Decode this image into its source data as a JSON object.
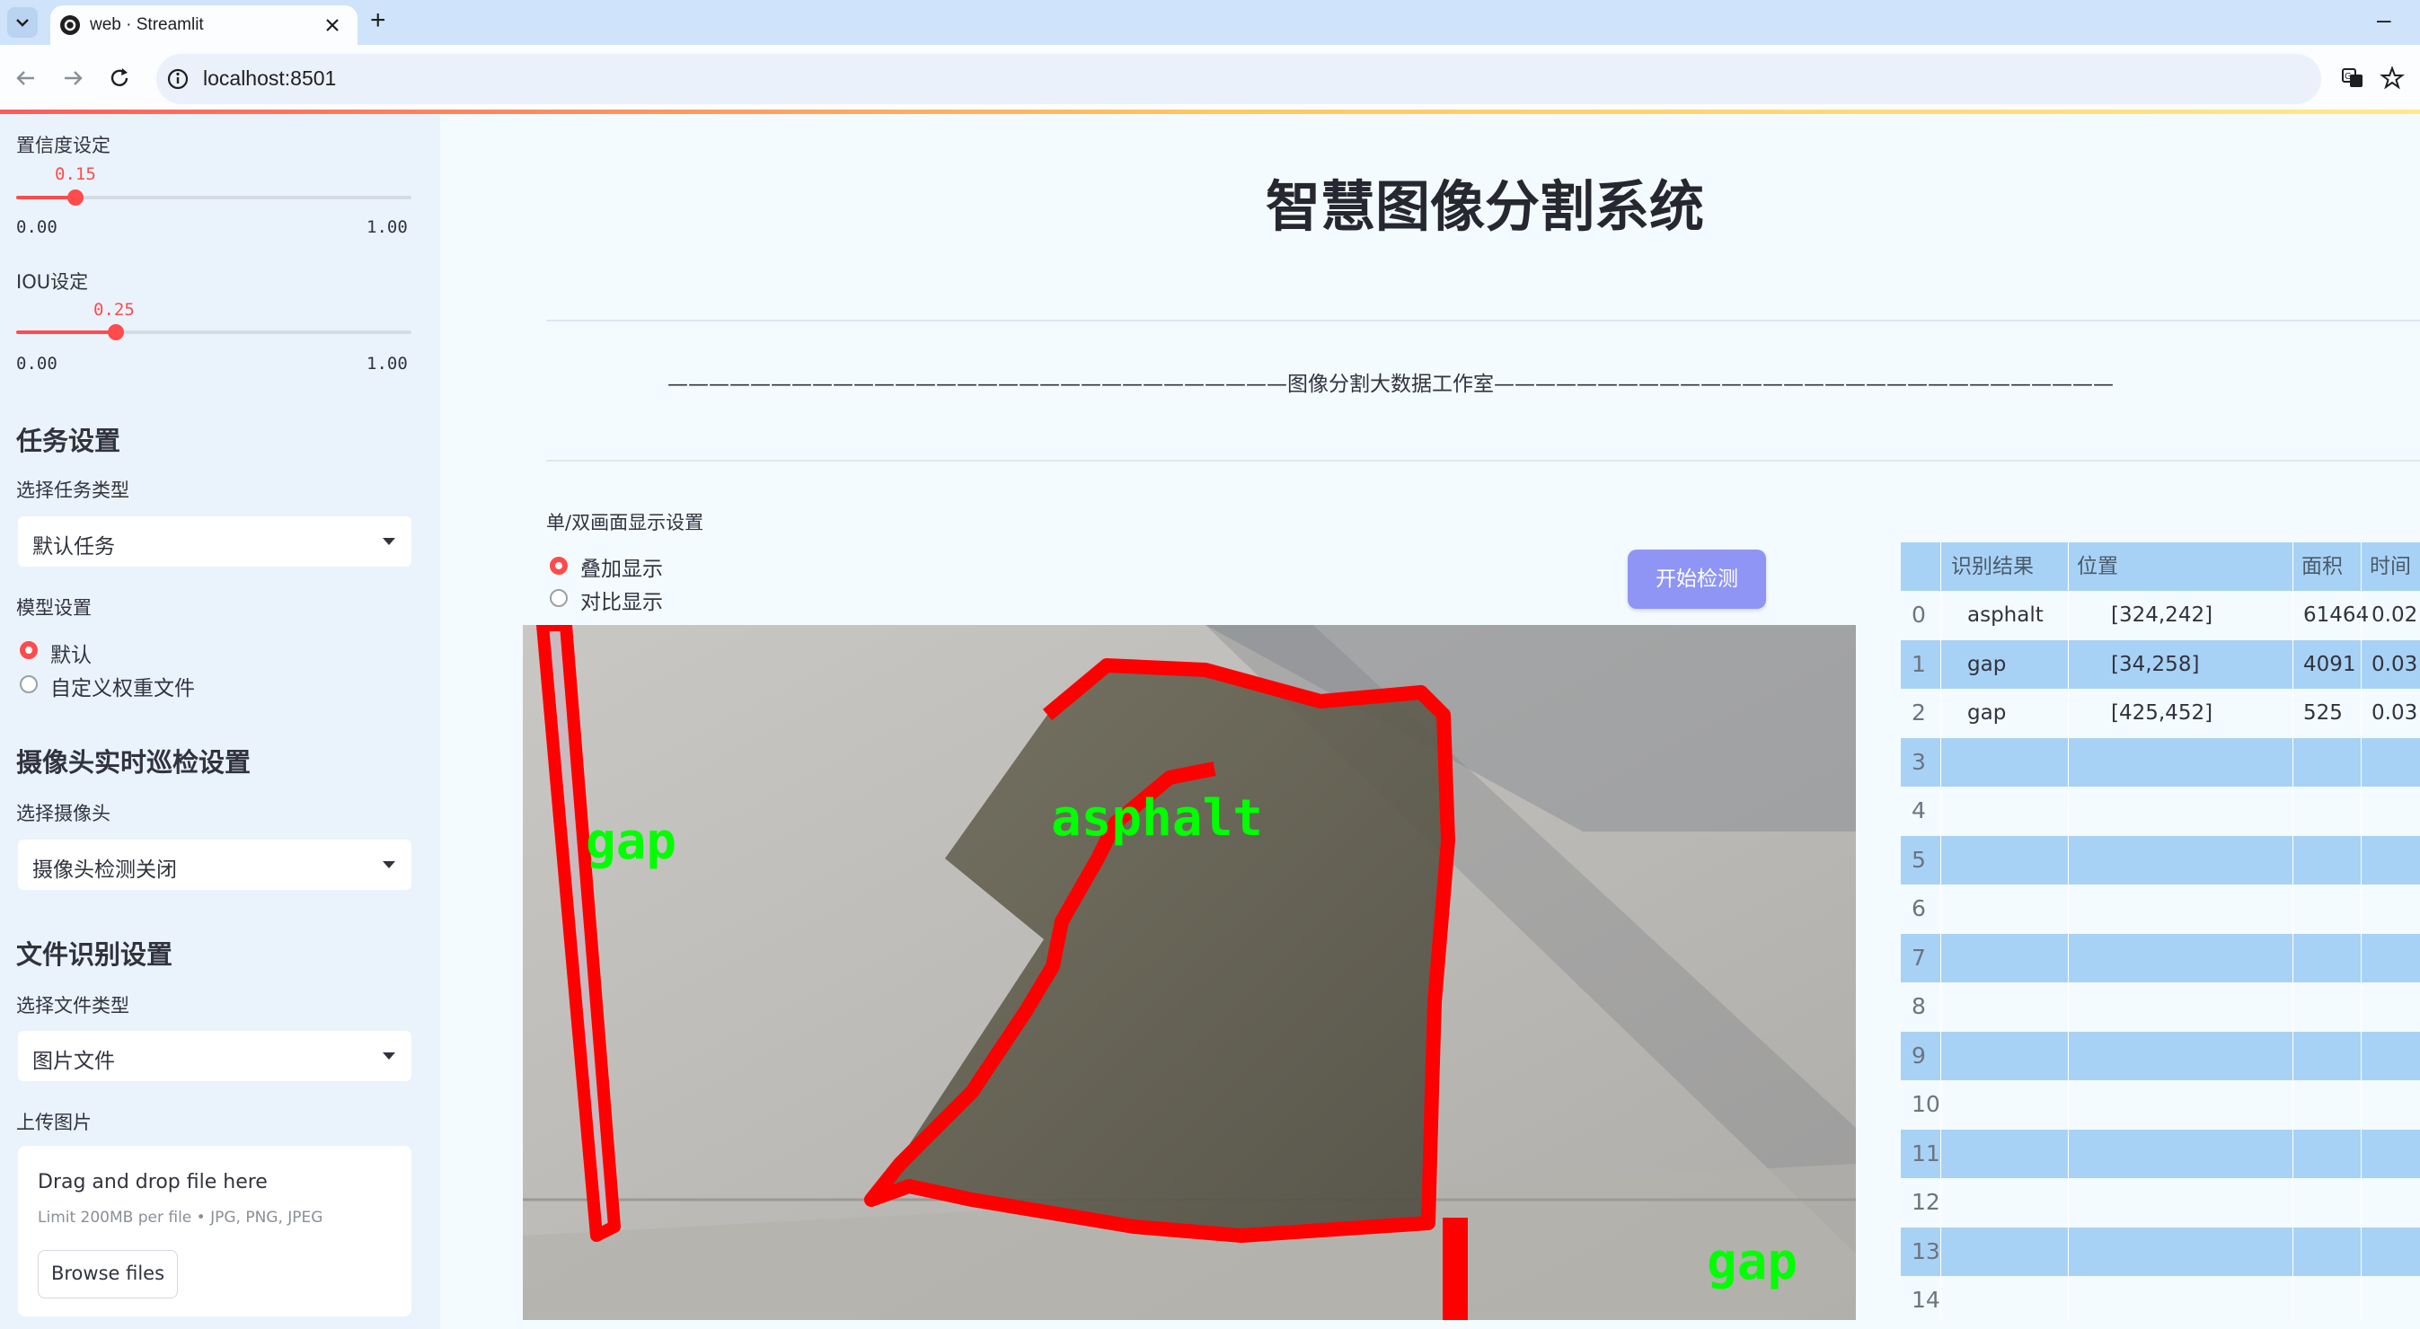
{
  "browser": {
    "tab_title": "web · Streamlit",
    "url": "localhost:8501",
    "new_tab": "+",
    "minimize": "–"
  },
  "sidebar": {
    "confidence": {
      "label": "置信度设定",
      "value": "0.15",
      "min": "0.00",
      "max": "1.00",
      "fraction": 0.15
    },
    "iou": {
      "label": "IOU设定",
      "value": "0.25",
      "min": "0.00",
      "max": "1.00",
      "fraction": 0.25
    },
    "task_section": {
      "heading": "任务设置",
      "select_label": "选择任务类型",
      "selected": "默认任务"
    },
    "model_section": {
      "label": "模型设置",
      "options": [
        "默认",
        "自定义权重文件"
      ],
      "selected_index": 0
    },
    "camera_section": {
      "heading": "摄像头实时巡检设置",
      "select_label": "选择摄像头",
      "selected": "摄像头检测关闭"
    },
    "file_section": {
      "heading": "文件识别设置",
      "select_label": "选择文件类型",
      "selected": "图片文件"
    },
    "upload": {
      "label": "上传图片",
      "drop_text": "Drag and drop file here",
      "limit_text": "Limit 200MB per file • JPG, PNG, JPEG",
      "browse_button": "Browse files"
    }
  },
  "main": {
    "title": "智慧图像分割系统",
    "divider_text": "——————————————————————————————图像分割大数据工作室——————————————————————————————",
    "display_setting": {
      "label": "单/双画面显示设置",
      "options": [
        "叠加显示",
        "对比显示"
      ],
      "selected_index": 0
    },
    "start_button": "开始检测",
    "image_labels": [
      "gap",
      "asphalt",
      "gap"
    ]
  },
  "results_table": {
    "columns": [
      "识别结果",
      "位置",
      "面积",
      "时间"
    ],
    "rows": [
      {
        "index": "0",
        "result": "asphalt",
        "position": "[324,242]",
        "area": "61464",
        "time": "0.02"
      },
      {
        "index": "1",
        "result": "gap",
        "position": "[34,258]",
        "area": "4091",
        "time": "0.03"
      },
      {
        "index": "2",
        "result": "gap",
        "position": "[425,452]",
        "area": "525",
        "time": "0.03"
      },
      {
        "index": "3"
      },
      {
        "index": "4"
      },
      {
        "index": "5"
      },
      {
        "index": "6"
      },
      {
        "index": "7"
      },
      {
        "index": "8"
      },
      {
        "index": "9"
      },
      {
        "index": "10"
      },
      {
        "index": "11"
      },
      {
        "index": "12"
      },
      {
        "index": "13"
      },
      {
        "index": "14"
      }
    ]
  },
  "colors": {
    "accent": "#ff4b4b",
    "button": "#8f95f5",
    "table_header": "#a8d2f5",
    "table_stripe": "#a8d2f5",
    "mask_outline": "#ff0000",
    "mask_label": "#00ff00"
  }
}
